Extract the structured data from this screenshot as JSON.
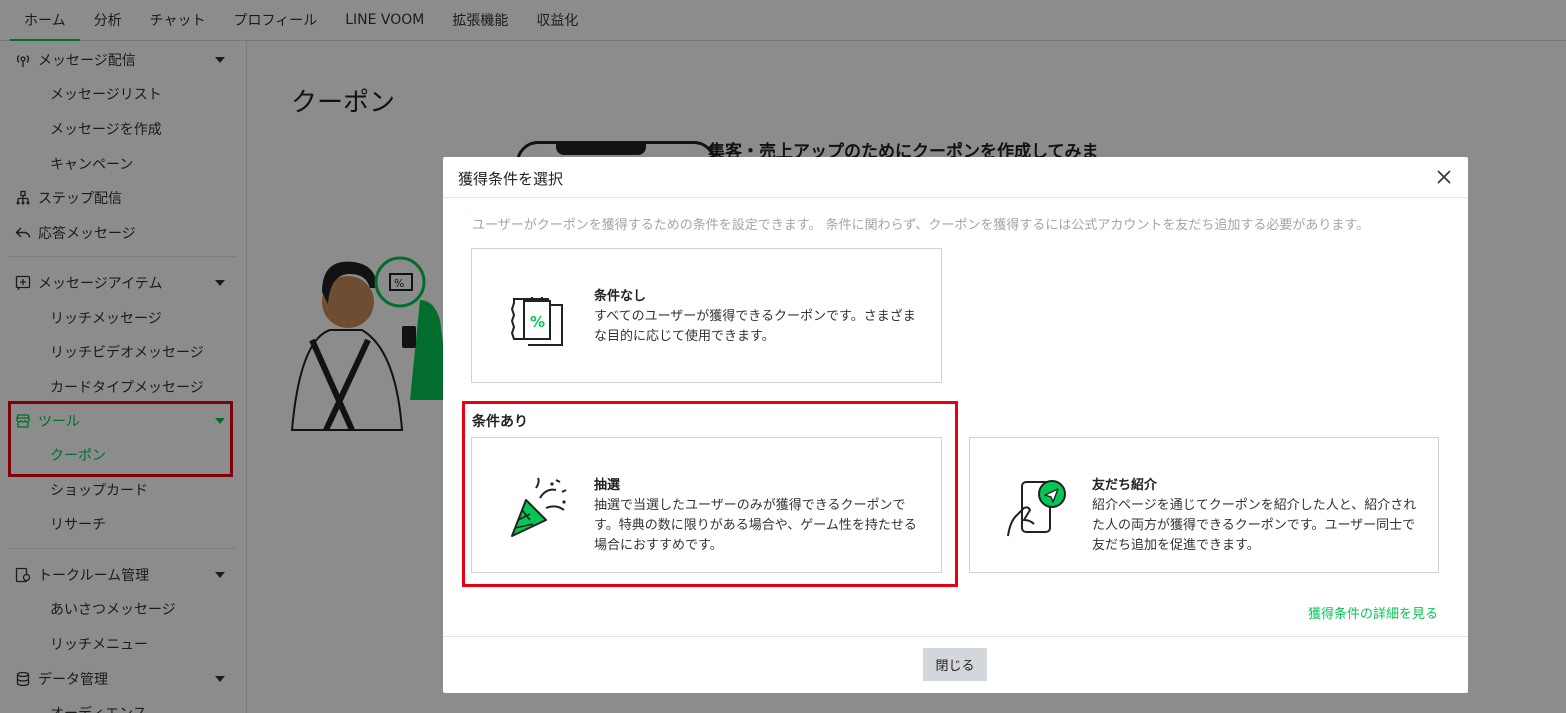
{
  "topnav": {
    "tabs": [
      "ホーム",
      "分析",
      "チャット",
      "プロフィール",
      "LINE VOOM",
      "拡張機能",
      "収益化"
    ]
  },
  "sidebar": {
    "message_delivery": "メッセージ配信",
    "message_list": "メッセージリスト",
    "create_message": "メッセージを作成",
    "campaign": "キャンペーン",
    "step_delivery": "ステップ配信",
    "auto_response": "応答メッセージ",
    "message_items": "メッセージアイテム",
    "rich_message": "リッチメッセージ",
    "rich_video_message": "リッチビデオメッセージ",
    "card_type_message": "カードタイプメッセージ",
    "tools": "ツール",
    "coupon": "クーポン",
    "shop_card": "ショップカード",
    "research": "リサーチ",
    "talk_room": "トークルーム管理",
    "greeting_message": "あいさつメッセージ",
    "rich_menu": "リッチメニュー",
    "data_management": "データ管理",
    "audience": "オーディエンス"
  },
  "main": {
    "title": "クーポン",
    "heading": "集客・売上アップのためにクーポンを作成してみま"
  },
  "modal": {
    "title": "獲得条件を選択",
    "description": "ユーザーがクーポンを獲得するための条件を設定できます。 条件に関わらず、クーポンを獲得するには公式アカウントを友だち追加する必要があります。",
    "no_condition": {
      "title": "条件なし",
      "description": "すべてのユーザーが獲得できるクーポンです。さまざまな目的に応じて使用できます。"
    },
    "with_condition_label": "条件あり",
    "lottery": {
      "title": "抽選",
      "description": "抽選で当選したユーザーのみが獲得できるクーポンです。特典の数に限りがある場合や、ゲーム性を持たせる場合におすすめです。"
    },
    "referral": {
      "title": "友だち紹介",
      "description": "紹介ページを通じてクーポンを紹介した人と、紹介された人の両方が獲得できるクーポンです。ユーザー同士で友だち追加を促進できます。"
    },
    "detail_link": "獲得条件の詳細を見る",
    "close_button": "閉じる"
  },
  "colors": {
    "accent": "#06c755",
    "highlight": "#e60012"
  }
}
